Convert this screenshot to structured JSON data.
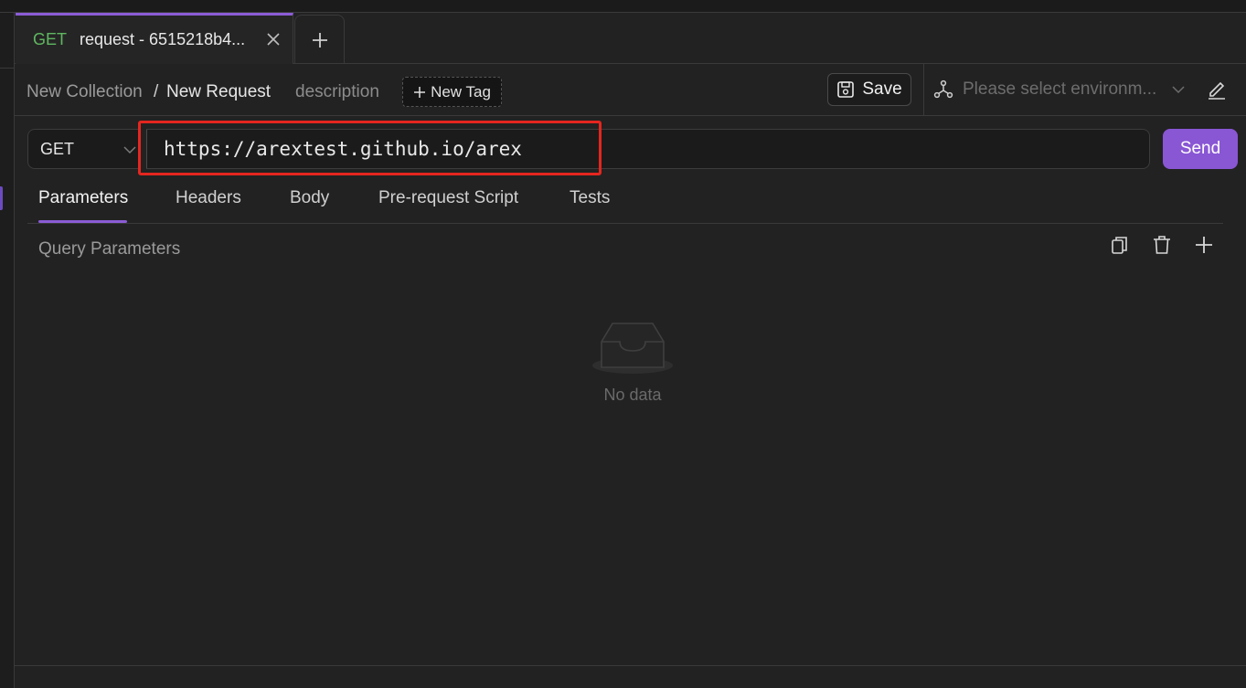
{
  "tabs": [
    {
      "method": "GET",
      "title": "request - 6515218b4..."
    }
  ],
  "breadcrumb": {
    "collection": "New Collection",
    "separator": "/",
    "request": "New Request"
  },
  "description_label": "description",
  "new_tag_label": "New Tag",
  "save_label": "Save",
  "environment": {
    "placeholder": "Please select environm..."
  },
  "request": {
    "method": "GET",
    "url": "https://arextest.github.io/arex",
    "send_label": "Send"
  },
  "request_tabs": [
    "Parameters",
    "Headers",
    "Body",
    "Pre-request Script",
    "Tests"
  ],
  "active_request_tab": "Parameters",
  "query_params": {
    "title": "Query Parameters",
    "empty_text": "No data"
  },
  "colors": {
    "accent": "#8956d4",
    "method_get": "#5fb760",
    "highlight": "#e5261f"
  }
}
